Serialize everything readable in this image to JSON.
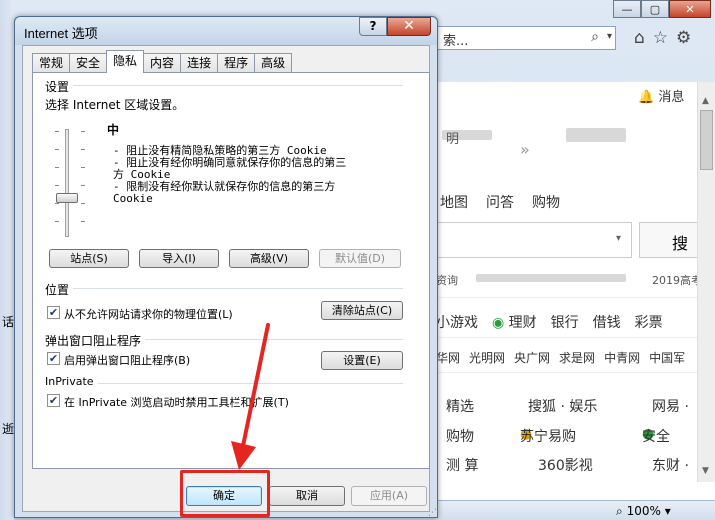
{
  "background": {
    "address_text": "索...",
    "message_label": "消息",
    "nav": [
      "地图",
      "问答",
      "购物"
    ],
    "search_button": "搜",
    "row1_left": "资询",
    "row1_right": "2019高考",
    "categories": [
      "小游戏",
      "理财",
      "银行",
      "借钱",
      "彩票"
    ],
    "sites": [
      "华网",
      "光明网",
      "央广网",
      "求是网",
      "中青网",
      "中国军"
    ],
    "grid": [
      "精选",
      "搜狐 · 娱乐",
      "网易 ·",
      "购物",
      "苏宁易购",
      "安全",
      "测 算",
      "360影视",
      "东财 ·"
    ],
    "zoom": "100%",
    "left_char_1": "话",
    "left_char_2": "逝",
    "page_chars": "明",
    "double_arrow": "»"
  },
  "dialog": {
    "title": "Internet 选项",
    "help_label": "?",
    "close_label": "✕",
    "tabs": [
      "常规",
      "安全",
      "隐私",
      "内容",
      "连接",
      "程序",
      "高级"
    ],
    "active_tab": "隐私",
    "settings": {
      "group_label": "设置",
      "zone_text": "选择 Internet 区域设置。",
      "level": "中",
      "desc1": "- 阻止没有精简隐私策略的第三方 Cookie",
      "desc2a": "- 阻止没有经你明确同意就保存你的信息的第三",
      "desc2b": "方 Cookie",
      "desc3a": "- 限制没有经你默认就保存你的信息的第三方",
      "desc3b": "Cookie",
      "level_fraction": 0.65,
      "buttons": {
        "sites": "站点(S)",
        "import": "导入(I)",
        "advanced": "高级(V)",
        "default": "默认值(D)"
      }
    },
    "location": {
      "group_label": "位置",
      "checkbox_label": "从不允许网站请求你的物理位置(L)",
      "checked": true,
      "clear_button": "清除站点(C)"
    },
    "popup": {
      "group_label": "弹出窗口阻止程序",
      "checkbox_label": "启用弹出窗口阻止程序(B)",
      "checked": true,
      "settings_button": "设置(E)"
    },
    "inprivate": {
      "group_label": "InPrivate",
      "checkbox_label": "在 InPrivate 浏览启动时禁用工具栏和扩展(T)",
      "checked": true
    },
    "footer": {
      "ok": "确定",
      "cancel": "取消",
      "apply": "应用(A)"
    }
  },
  "colors": {
    "highlight": "#e5251f",
    "dialog_frame": "#d4e0ee",
    "check_mark": "#1f3b6e"
  }
}
